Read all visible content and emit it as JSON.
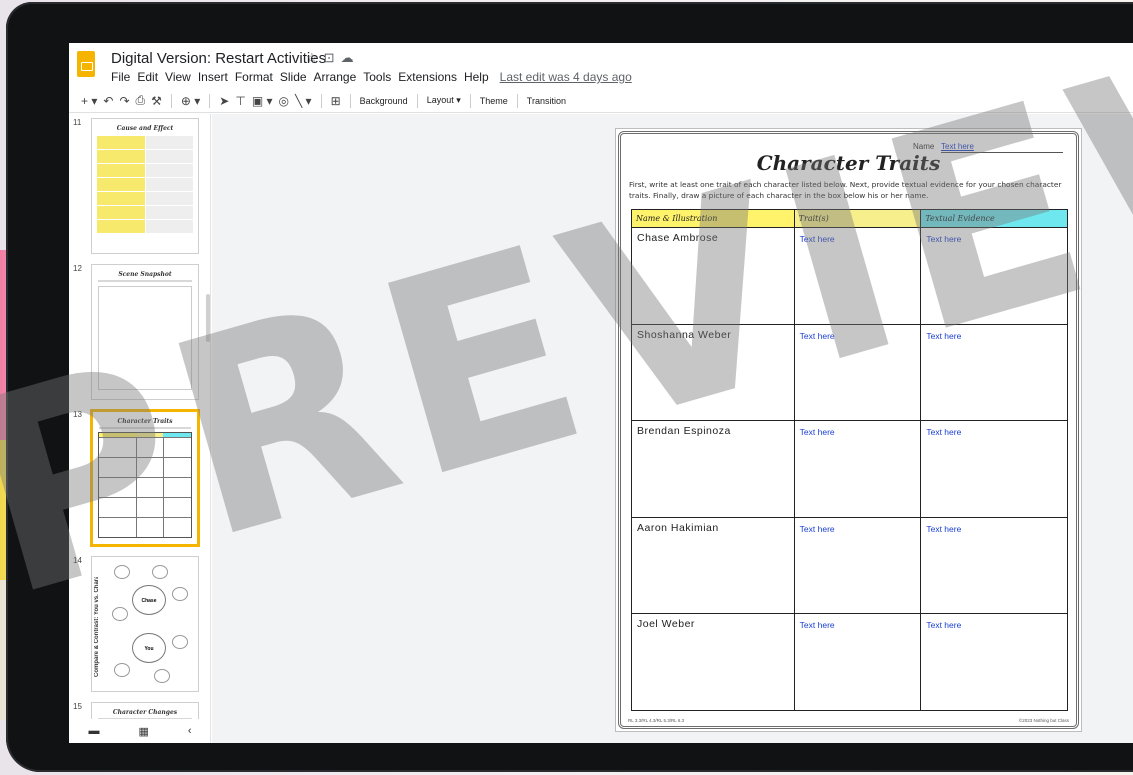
{
  "header": {
    "title": "Digital Version: Restart Activities",
    "title_icons": [
      "star-icon",
      "move-to-folder-icon",
      "cloud-status-icon"
    ],
    "menu": [
      "File",
      "Edit",
      "View",
      "Insert",
      "Format",
      "Slide",
      "Arrange",
      "Tools",
      "Extensions",
      "Help"
    ],
    "last_edit": "Last edit was 4 days ago"
  },
  "toolbar": {
    "icons": [
      "add-icon",
      "undo-icon",
      "redo-icon",
      "print-icon",
      "paint-format-icon",
      "zoom-icon",
      "select-icon",
      "text-box-icon",
      "image-icon",
      "shape-icon",
      "line-icon",
      "comment-icon"
    ],
    "background_label": "Background",
    "layout_label": "Layout",
    "theme_label": "Theme",
    "transition_label": "Transition"
  },
  "filmstrip": {
    "slides": [
      {
        "number": "11",
        "title": "Cause and Effect"
      },
      {
        "number": "12",
        "title": "Scene Snapshot"
      },
      {
        "number": "13",
        "title": "Character Traits"
      },
      {
        "number": "14",
        "title": "Compare & Contrast: You vs. Character"
      },
      {
        "number": "15",
        "title": "Character Changes"
      }
    ],
    "thumb14_labels": {
      "center_top": "Chase",
      "center_bottom": "You"
    }
  },
  "slide": {
    "name_label": "Name",
    "name_value": "Text here",
    "title": "Character Traits",
    "instructions": "First, write at least one trait of each character listed below. Next, provide textual evidence for your chosen character traits. Finally, draw a picture of each character in the box below his or her name.",
    "headers": {
      "name": "Name & Illustration",
      "traits": "Trait(s)",
      "evidence": "Textual Evidence"
    },
    "rows": [
      {
        "name": "Chase Ambrose",
        "trait": "Text here",
        "evidence": "Text here"
      },
      {
        "name": "Shoshanna Weber",
        "trait": "Text here",
        "evidence": "Text here"
      },
      {
        "name": "Brendan Espinoza",
        "trait": "Text here",
        "evidence": "Text here"
      },
      {
        "name": "Aaron Hakimian",
        "trait": "Text here",
        "evidence": "Text here"
      },
      {
        "name": "Joel Weber",
        "trait": "Text here",
        "evidence": "Text here"
      }
    ],
    "footer_left": "RL 3.3/RL 4.3/RL 5.3/RL 6.3",
    "footer_right": "©2023 Nothing but Class"
  },
  "watermark": "PREVIEW ONLY",
  "colors": {
    "accent": "#f4b400",
    "link": "#1a3fd1",
    "header_yellow": "#fff36b",
    "header_cyan": "#6ee7ee"
  }
}
